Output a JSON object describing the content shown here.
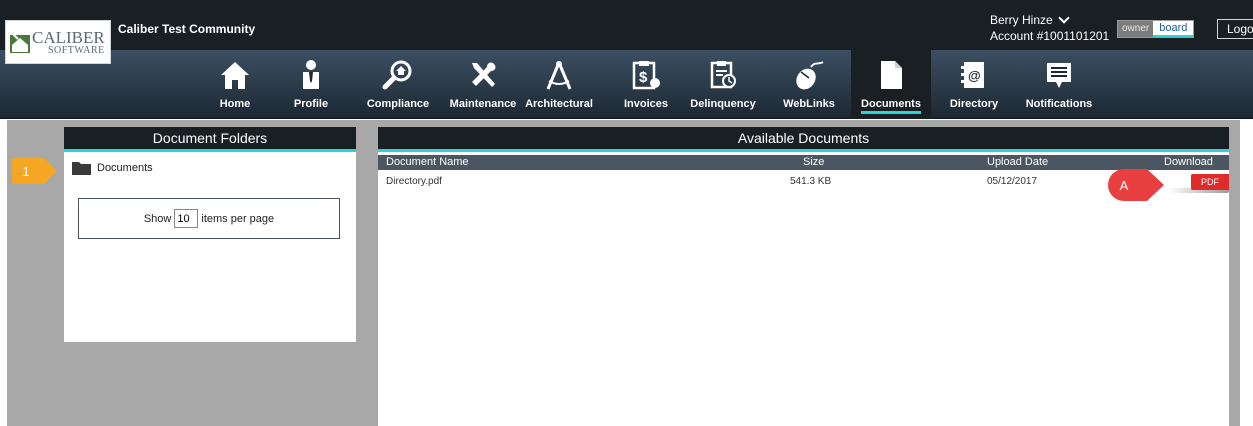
{
  "logo": {
    "line1": "CALIBER",
    "line2": "SOFTWARE"
  },
  "header": {
    "community": "Caliber Test Community",
    "user_name": "Berry Hinze",
    "account": "Account #1001101201",
    "role_owner": "owner",
    "role_board": "board",
    "logout_label": "Logout",
    "accent_color": "#2ed3d3"
  },
  "nav": {
    "items": [
      {
        "label": "Home",
        "icon": "home-icon"
      },
      {
        "label": "Profile",
        "icon": "person-icon"
      },
      {
        "label": "Compliance",
        "icon": "magnifier-icon"
      },
      {
        "label": "Maintenance",
        "icon": "tools-icon"
      },
      {
        "label": "Architectural",
        "icon": "compass-icon"
      },
      {
        "label": "Invoices",
        "icon": "invoice-icon"
      },
      {
        "label": "Delinquency",
        "icon": "clock-document-icon"
      },
      {
        "label": "WebLinks",
        "icon": "mouse-icon"
      },
      {
        "label": "Documents",
        "icon": "document-icon"
      },
      {
        "label": "Directory",
        "icon": "address-book-icon"
      },
      {
        "label": "Notifications",
        "icon": "message-icon"
      }
    ],
    "active": "Documents"
  },
  "folders": {
    "title": "Document Folders",
    "items": [
      {
        "name": "Documents"
      }
    ],
    "per_page": {
      "show": "Show",
      "value": "10",
      "suffix": "items per page"
    }
  },
  "documents": {
    "title": "Available Documents",
    "columns": {
      "name": "Document Name",
      "size": "Size",
      "date": "Upload Date",
      "download": "Download"
    },
    "rows": [
      {
        "name": "Directory.pdf",
        "size": "541.3 KB",
        "date": "05/12/2017",
        "download": "PDF"
      }
    ]
  },
  "callouts": {
    "one": "1",
    "a": "A",
    "one_color": "#f5a623",
    "a_color": "#e84040"
  }
}
